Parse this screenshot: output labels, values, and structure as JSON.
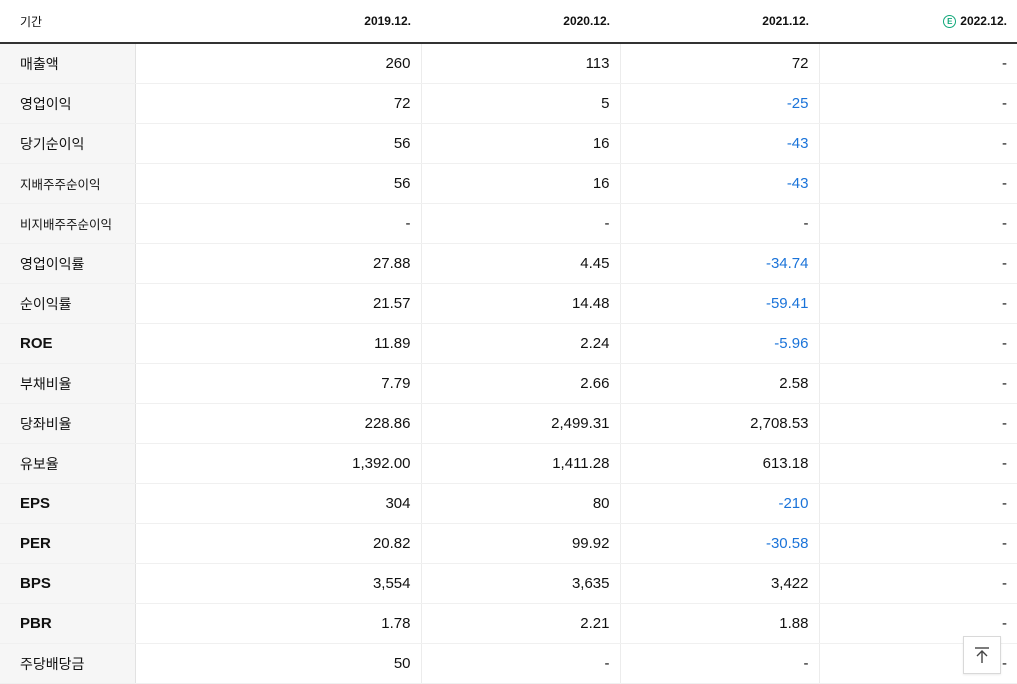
{
  "header": {
    "period_label": "기간",
    "periods": [
      "2019.12.",
      "2020.12.",
      "2021.12.",
      "2022.12."
    ],
    "estimate_mark": "E"
  },
  "rows": [
    {
      "label": "매출액",
      "values": [
        "260",
        "113",
        "72",
        "-"
      ]
    },
    {
      "label": "영업이익",
      "values": [
        "72",
        "5",
        "-25",
        "-"
      ]
    },
    {
      "label": "당기순이익",
      "values": [
        "56",
        "16",
        "-43",
        "-"
      ]
    },
    {
      "label": "지배주주순이익",
      "values": [
        "56",
        "16",
        "-43",
        "-"
      ]
    },
    {
      "label": "비지배주주순이익",
      "values": [
        "-",
        "-",
        "-",
        "-"
      ]
    },
    {
      "label": "영업이익률",
      "values": [
        "27.88",
        "4.45",
        "-34.74",
        "-"
      ]
    },
    {
      "label": "순이익률",
      "values": [
        "21.57",
        "14.48",
        "-59.41",
        "-"
      ]
    },
    {
      "label": "ROE",
      "values": [
        "11.89",
        "2.24",
        "-5.96",
        "-"
      ]
    },
    {
      "label": "부채비율",
      "values": [
        "7.79",
        "2.66",
        "2.58",
        "-"
      ]
    },
    {
      "label": "당좌비율",
      "values": [
        "228.86",
        "2,499.31",
        "2,708.53",
        "-"
      ]
    },
    {
      "label": "유보율",
      "values": [
        "1,392.00",
        "1,411.28",
        "613.18",
        "-"
      ]
    },
    {
      "label": "EPS",
      "values": [
        "304",
        "80",
        "-210",
        "-"
      ]
    },
    {
      "label": "PER",
      "values": [
        "20.82",
        "99.92",
        "-30.58",
        "-"
      ]
    },
    {
      "label": "BPS",
      "values": [
        "3,554",
        "3,635",
        "3,422",
        "-"
      ]
    },
    {
      "label": "PBR",
      "values": [
        "1.78",
        "2.21",
        "1.88",
        "-"
      ]
    },
    {
      "label": "주당배당금",
      "values": [
        "50",
        "-",
        "-",
        "-"
      ]
    }
  ],
  "colors": {
    "negative": "#1a73d9",
    "estimate": "#11a87a"
  },
  "icons": {
    "scroll_top": "arrow-up-to-line-icon"
  }
}
